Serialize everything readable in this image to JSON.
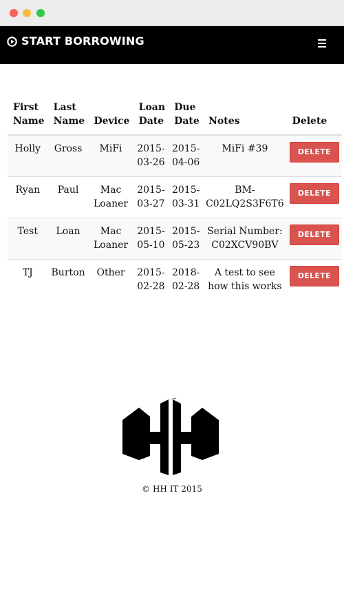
{
  "window": {
    "controls": [
      "close",
      "minimize",
      "maximize"
    ],
    "colors": {
      "close": "#fc605c",
      "minimize": "#fdbc40",
      "maximize": "#34c84a"
    }
  },
  "navbar": {
    "brand_icon": "play-circle-icon",
    "brand": "START BORROWING",
    "menu_icon": "hamburger-menu-icon"
  },
  "table": {
    "headers": {
      "first_name": "First Name",
      "last_name": "Last Name",
      "device": "Device",
      "loan_date": "Loan Date",
      "due_date": "Due Date",
      "notes": "Notes",
      "delete": "Delete"
    },
    "rows": [
      {
        "first_name": "Holly",
        "last_name": "Gross",
        "device": "MiFi",
        "loan_date": "2015-03-26",
        "due_date": "2015-04-06",
        "notes": "MiFi #39",
        "delete_label": "DELETE"
      },
      {
        "first_name": "Ryan",
        "last_name": "Paul",
        "device": "Mac Loaner",
        "loan_date": "2015-03-27",
        "due_date": "2015-03-31",
        "notes": "BM-C02LQ2S3F6T6",
        "delete_label": "DELETE"
      },
      {
        "first_name": "Test",
        "last_name": "Loan",
        "device": "Mac Loaner",
        "loan_date": "2015-05-10",
        "due_date": "2015-05-23",
        "notes": "Serial Number: C02XCV90BV",
        "delete_label": "DELETE"
      },
      {
        "first_name": "TJ",
        "last_name": "Burton",
        "device": "Other",
        "loan_date": "2015-02-28",
        "due_date": "2018-02-28",
        "notes": "A test to see how this works",
        "delete_label": "DELETE"
      }
    ]
  },
  "footer": {
    "logo_icon": "hh-logo-icon",
    "copyright": "© HH IT 2015"
  },
  "colors": {
    "navbar_bg": "#000000",
    "delete_button": "#d9534f",
    "row_stripe": "#f9f9f9"
  }
}
